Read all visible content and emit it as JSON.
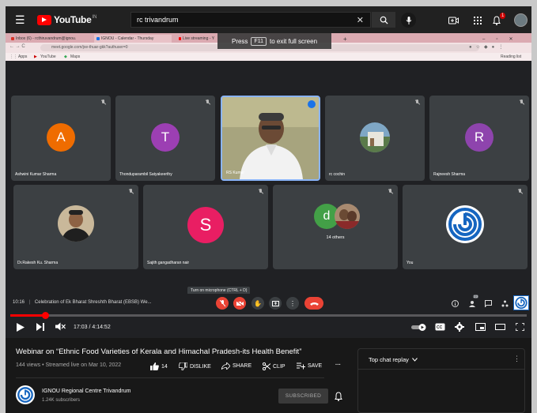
{
  "youtube": {
    "logo_text": "YouTube",
    "logo_sup": "IN",
    "search_query": "rc trivandrum",
    "notification_count": "1"
  },
  "browser": {
    "tabs": [
      "Inbox (6) - rcthiruvandrum@ignou.",
      "IGNOU - Calendar - Thursday",
      "Live streaming - YouTube"
    ],
    "url": "meet.google.com/jxe-thuar-gkk?authuser=0",
    "bookmarks": [
      "Apps",
      "YouTube",
      "Maps"
    ],
    "reading_list": "Reading list",
    "fullscreen_tip": {
      "pre": "Press",
      "key": "F11",
      "post": "to exit full screen"
    }
  },
  "meet": {
    "participants": [
      {
        "name": "Ashwini Kumar Sharma",
        "initial": "A",
        "color": "#ef6c00"
      },
      {
        "name": "Thonduparambil Satyakeerthy",
        "initial": "T",
        "color": "#9c3fb3"
      },
      {
        "name": "RS Kumar",
        "initial": "",
        "color": ""
      },
      {
        "name": "rc cochin",
        "initial": "",
        "color": ""
      },
      {
        "name": "Rajneesh Sharma",
        "initial": "R",
        "color": "#8e44ad"
      },
      {
        "name": "Dr.Rakesh Ku. Sharma",
        "initial": "",
        "color": ""
      },
      {
        "name": "Sajith gangadharan nair",
        "initial": "S",
        "color": "#e91e63"
      },
      {
        "name": "14 others",
        "initial": "d",
        "color": "#43a047"
      },
      {
        "name": "You",
        "initial": "",
        "color": ""
      }
    ],
    "time": "10:16",
    "meeting_title": "Celebration of Ek Bharat Shreshth Bharat (EBSB) We...",
    "mic_tooltip": "Turn on microphone (CTRL + D)",
    "people_count": "23"
  },
  "player": {
    "time": "17:03 / 4:14:52",
    "progress": 0.067
  },
  "video": {
    "title": "Webinar on “Ethnic Food Varieties of Kerala and Himachal Pradesh-its Health Benefit”",
    "meta": "144 views • Streamed live on Mar 10, 2022",
    "likes": "14",
    "dislike_label": "DISLIKE",
    "share_label": "SHARE",
    "clip_label": "CLIP",
    "save_label": "SAVE",
    "more_label": "···"
  },
  "channel": {
    "name": "IGNOU Regional Centre Trivandrum",
    "subs": "1.24K subscribers",
    "subscribed_label": "SUBSCRIBED"
  },
  "chat": {
    "title": "Top chat replay",
    "more": "⋮"
  },
  "colors": {
    "yt_red": "#ff0000",
    "meet_red": "#ea4335",
    "tile_bg": "#3c4043",
    "active_border": "#8ab4f8"
  }
}
